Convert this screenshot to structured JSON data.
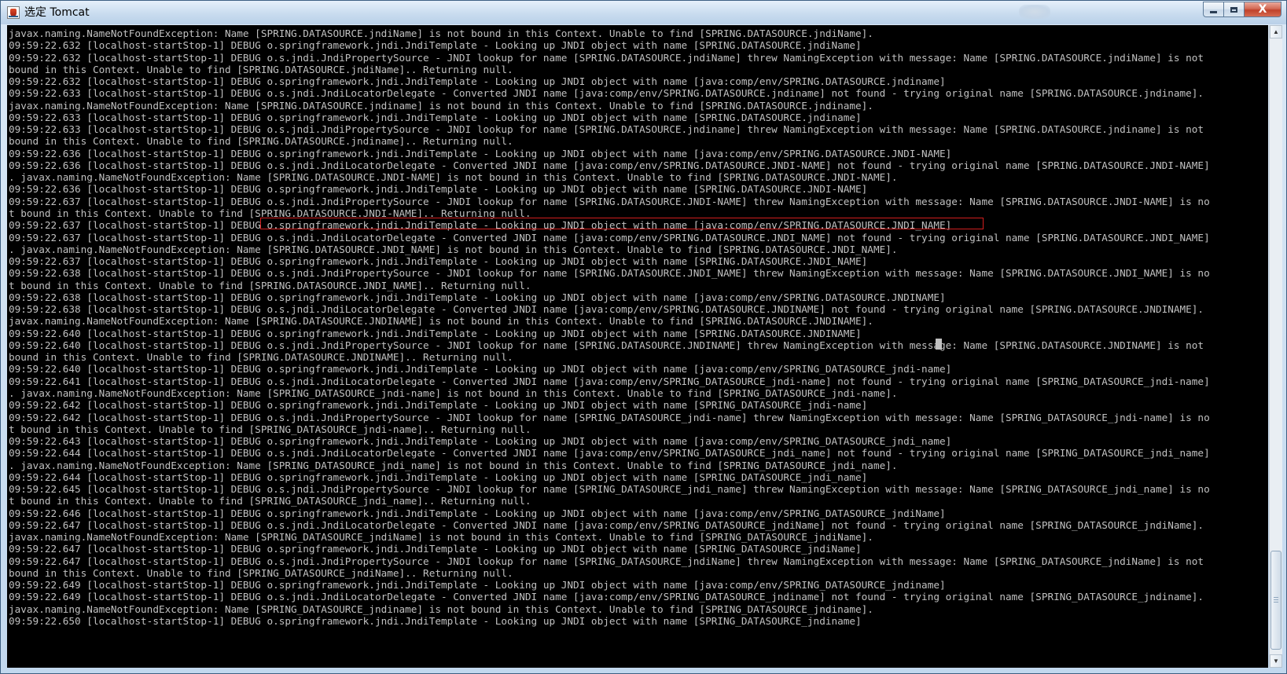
{
  "window": {
    "title": "选定 Tomcat",
    "min_glyph": "",
    "max_glyph": "",
    "close_glyph": "X"
  },
  "console": {
    "lines": [
      "javax.naming.NameNotFoundException: Name [SPRING.DATASOURCE.jndiName] is not bound in this Context. Unable to find [SPRING.DATASOURCE.jndiName].",
      "09:59:22.632 [localhost-startStop-1] DEBUG o.springframework.jndi.JndiTemplate - Looking up JNDI object with name [SPRING.DATASOURCE.jndiName]",
      "09:59:22.632 [localhost-startStop-1] DEBUG o.s.jndi.JndiPropertySource - JNDI lookup for name [SPRING.DATASOURCE.jndiName] threw NamingException with message: Name [SPRING.DATASOURCE.jndiName] is not",
      "bound in this Context. Unable to find [SPRING.DATASOURCE.jndiName].. Returning null.",
      "09:59:22.632 [localhost-startStop-1] DEBUG o.springframework.jndi.JndiTemplate - Looking up JNDI object with name [java:comp/env/SPRING.DATASOURCE.jndiname]",
      "09:59:22.633 [localhost-startStop-1] DEBUG o.s.jndi.JndiLocatorDelegate - Converted JNDI name [java:comp/env/SPRING.DATASOURCE.jndiname] not found - trying original name [SPRING.DATASOURCE.jndiname].",
      "javax.naming.NameNotFoundException: Name [SPRING.DATASOURCE.jndiname] is not bound in this Context. Unable to find [SPRING.DATASOURCE.jndiname].",
      "09:59:22.633 [localhost-startStop-1] DEBUG o.springframework.jndi.JndiTemplate - Looking up JNDI object with name [SPRING.DATASOURCE.jndiname]",
      "09:59:22.633 [localhost-startStop-1] DEBUG o.s.jndi.JndiPropertySource - JNDI lookup for name [SPRING.DATASOURCE.jndiname] threw NamingException with message: Name [SPRING.DATASOURCE.jndiname] is not",
      "bound in this Context. Unable to find [SPRING.DATASOURCE.jndiname].. Returning null.",
      "09:59:22.636 [localhost-startStop-1] DEBUG o.springframework.jndi.JndiTemplate - Looking up JNDI object with name [java:comp/env/SPRING.DATASOURCE.JNDI-NAME]",
      "09:59:22.636 [localhost-startStop-1] DEBUG o.s.jndi.JndiLocatorDelegate - Converted JNDI name [java:comp/env/SPRING.DATASOURCE.JNDI-NAME] not found - trying original name [SPRING.DATASOURCE.JNDI-NAME]",
      ". javax.naming.NameNotFoundException: Name [SPRING.DATASOURCE.JNDI-NAME] is not bound in this Context. Unable to find [SPRING.DATASOURCE.JNDI-NAME].",
      "09:59:22.636 [localhost-startStop-1] DEBUG o.springframework.jndi.JndiTemplate - Looking up JNDI object with name [SPRING.DATASOURCE.JNDI-NAME]",
      "09:59:22.637 [localhost-startStop-1] DEBUG o.s.jndi.JndiPropertySource - JNDI lookup for name [SPRING.DATASOURCE.JNDI-NAME] threw NamingException with message: Name [SPRING.DATASOURCE.JNDI-NAME] is no",
      "t bound in this Context. Unable to find [SPRING.DATASOURCE.JNDI-NAME].. Returning null.",
      "09:59:22.637 [localhost-startStop-1] DEBUG o.springframework.jndi.JndiTemplate - Looking up JNDI object with name [java:comp/env/SPRING.DATASOURCE.JNDI_NAME]",
      "09:59:22.637 [localhost-startStop-1] DEBUG o.s.jndi.JndiLocatorDelegate - Converted JNDI name [java:comp/env/SPRING.DATASOURCE.JNDI_NAME] not found - trying original name [SPRING.DATASOURCE.JNDI_NAME]",
      ". javax.naming.NameNotFoundException: Name [SPRING.DATASOURCE.JNDI_NAME] is not bound in this Context. Unable to find [SPRING.DATASOURCE.JNDI_NAME].",
      "09:59:22.637 [localhost-startStop-1] DEBUG o.springframework.jndi.JndiTemplate - Looking up JNDI object with name [SPRING.DATASOURCE.JNDI_NAME]",
      "09:59:22.638 [localhost-startStop-1] DEBUG o.s.jndi.JndiPropertySource - JNDI lookup for name [SPRING.DATASOURCE.JNDI_NAME] threw NamingException with message: Name [SPRING.DATASOURCE.JNDI_NAME] is no",
      "t bound in this Context. Unable to find [SPRING.DATASOURCE.JNDI_NAME].. Returning null.",
      "09:59:22.638 [localhost-startStop-1] DEBUG o.springframework.jndi.JndiTemplate - Looking up JNDI object with name [java:comp/env/SPRING.DATASOURCE.JNDINAME]",
      "09:59:22.638 [localhost-startStop-1] DEBUG o.s.jndi.JndiLocatorDelegate - Converted JNDI name [java:comp/env/SPRING.DATASOURCE.JNDINAME] not found - trying original name [SPRING.DATASOURCE.JNDINAME].",
      "javax.naming.NameNotFoundException: Name [SPRING.DATASOURCE.JNDINAME] is not bound in this Context. Unable to find [SPRING.DATASOURCE.JNDINAME].",
      "09:59:22.640 [localhost-startStop-1] DEBUG o.springframework.jndi.JndiTemplate - Looking up JNDI object with name [SPRING.DATASOURCE.JNDINAME]",
      "09:59:22.640 [localhost-startStop-1] DEBUG o.s.jndi.JndiPropertySource - JNDI lookup for name [SPRING.DATASOURCE.JNDINAME] threw NamingException with message: Name [SPRING.DATASOURCE.JNDINAME] is not",
      "bound in this Context. Unable to find [SPRING.DATASOURCE.JNDINAME].. Returning null.",
      "09:59:22.640 [localhost-startStop-1] DEBUG o.springframework.jndi.JndiTemplate - Looking up JNDI object with name [java:comp/env/SPRING_DATASOURCE_jndi-name]",
      "09:59:22.641 [localhost-startStop-1] DEBUG o.s.jndi.JndiLocatorDelegate - Converted JNDI name [java:comp/env/SPRING_DATASOURCE_jndi-name] not found - trying original name [SPRING_DATASOURCE_jndi-name]",
      ". javax.naming.NameNotFoundException: Name [SPRING_DATASOURCE_jndi-name] is not bound in this Context. Unable to find [SPRING_DATASOURCE_jndi-name].",
      "09:59:22.642 [localhost-startStop-1] DEBUG o.springframework.jndi.JndiTemplate - Looking up JNDI object with name [SPRING_DATASOURCE_jndi-name]",
      "09:59:22.642 [localhost-startStop-1] DEBUG o.s.jndi.JndiPropertySource - JNDI lookup for name [SPRING_DATASOURCE_jndi-name] threw NamingException with message: Name [SPRING_DATASOURCE_jndi-name] is no",
      "t bound in this Context. Unable to find [SPRING_DATASOURCE_jndi-name].. Returning null.",
      "09:59:22.643 [localhost-startStop-1] DEBUG o.springframework.jndi.JndiTemplate - Looking up JNDI object with name [java:comp/env/SPRING_DATASOURCE_jndi_name]",
      "09:59:22.644 [localhost-startStop-1] DEBUG o.s.jndi.JndiLocatorDelegate - Converted JNDI name [java:comp/env/SPRING_DATASOURCE_jndi_name] not found - trying original name [SPRING_DATASOURCE_jndi_name]",
      ". javax.naming.NameNotFoundException: Name [SPRING_DATASOURCE_jndi_name] is not bound in this Context. Unable to find [SPRING_DATASOURCE_jndi_name].",
      "09:59:22.644 [localhost-startStop-1] DEBUG o.springframework.jndi.JndiTemplate - Looking up JNDI object with name [SPRING_DATASOURCE_jndi_name]",
      "09:59:22.645 [localhost-startStop-1] DEBUG o.s.jndi.JndiPropertySource - JNDI lookup for name [SPRING_DATASOURCE_jndi_name] threw NamingException with message: Name [SPRING_DATASOURCE_jndi_name] is no",
      "t bound in this Context. Unable to find [SPRING_DATASOURCE_jndi_name].. Returning null.",
      "09:59:22.646 [localhost-startStop-1] DEBUG o.springframework.jndi.JndiTemplate - Looking up JNDI object with name [java:comp/env/SPRING_DATASOURCE_jndiName]",
      "09:59:22.647 [localhost-startStop-1] DEBUG o.s.jndi.JndiLocatorDelegate - Converted JNDI name [java:comp/env/SPRING_DATASOURCE_jndiName] not found - trying original name [SPRING_DATASOURCE_jndiName].",
      "javax.naming.NameNotFoundException: Name [SPRING_DATASOURCE_jndiName] is not bound in this Context. Unable to find [SPRING_DATASOURCE_jndiName].",
      "09:59:22.647 [localhost-startStop-1] DEBUG o.springframework.jndi.JndiTemplate - Looking up JNDI object with name [SPRING_DATASOURCE_jndiName]",
      "09:59:22.647 [localhost-startStop-1] DEBUG o.s.jndi.JndiPropertySource - JNDI lookup for name [SPRING_DATASOURCE_jndiName] threw NamingException with message: Name [SPRING_DATASOURCE_jndiName] is not",
      "bound in this Context. Unable to find [SPRING_DATASOURCE_jndiName].. Returning null.",
      "09:59:22.649 [localhost-startStop-1] DEBUG o.springframework.jndi.JndiTemplate - Looking up JNDI object with name [java:comp/env/SPRING_DATASOURCE_jndiname]",
      "09:59:22.649 [localhost-startStop-1] DEBUG o.s.jndi.JndiLocatorDelegate - Converted JNDI name [java:comp/env/SPRING_DATASOURCE_jndiname] not found - trying original name [SPRING_DATASOURCE_jndiname].",
      "javax.naming.NameNotFoundException: Name [SPRING_DATASOURCE_jndiname] is not bound in this Context. Unable to find [SPRING_DATASOURCE_jndiname].",
      "09:59:22.650 [localhost-startStop-1] DEBUG o.springframework.jndi.JndiTemplate - Looking up JNDI object with name [SPRING_DATASOURCE_jndiname]"
    ],
    "highlighted_line_index": 16
  },
  "colors": {
    "console_bg": "#000000",
    "console_text": "#c0c0c0",
    "highlight_box": "#d21e1e",
    "titlebar": "#c9dcef"
  },
  "icons": {
    "app": "java-console-icon",
    "minimize": "minimize-icon",
    "maximize": "maximize-icon",
    "close": "close-icon",
    "scroll_up": "scroll-up-arrow-icon",
    "scroll_down": "scroll-down-arrow-icon"
  }
}
